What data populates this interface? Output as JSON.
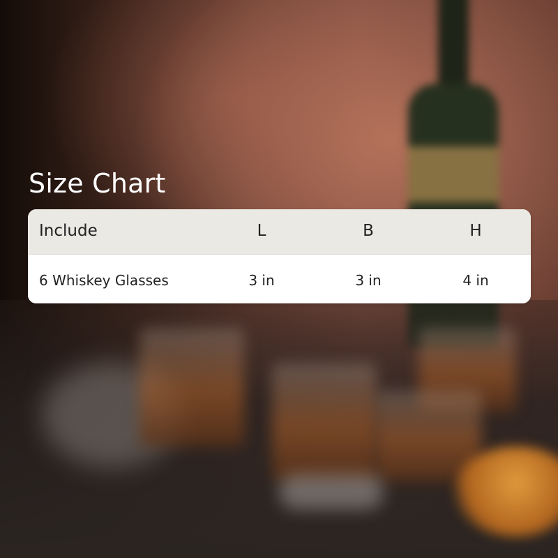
{
  "title": "Size Chart",
  "table": {
    "headers": [
      "Include",
      "L",
      "B",
      "H"
    ],
    "rows": [
      [
        "6 Whiskey Glasses",
        "3 in",
        "3 in",
        "4 in"
      ]
    ]
  },
  "colors": {
    "header_bg": "#ebe9e3",
    "row_bg": "#ffffff",
    "text": "#222222",
    "title": "#ffffff"
  }
}
